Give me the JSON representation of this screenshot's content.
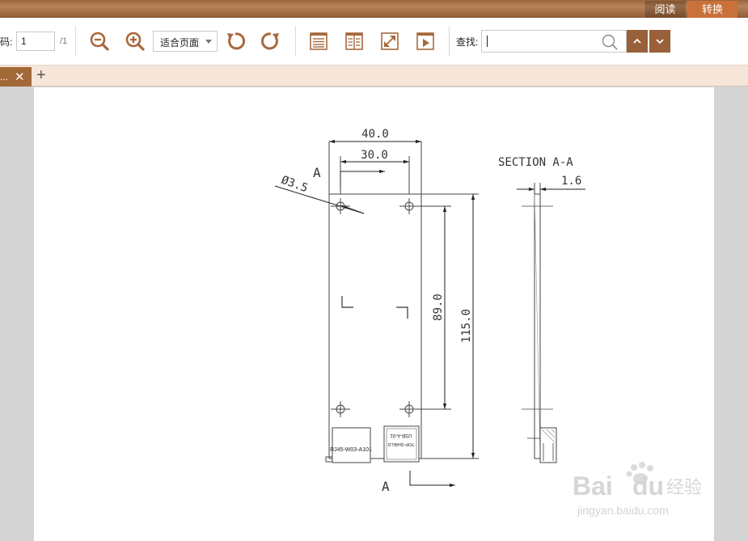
{
  "titlebar": {
    "read_label": "阅读",
    "convert_label": "转换"
  },
  "toolbar": {
    "page_label": "码:",
    "page_value": "1",
    "page_total": "/1",
    "zoom_option": "适合页面",
    "search_label": "查找:",
    "search_value": ""
  },
  "tabbar": {
    "active_tab": "...",
    "close_glyph": "✕",
    "new_tab_glyph": "+"
  },
  "drawing": {
    "dim_40": "40.0",
    "dim_30": "30.0",
    "hole_dia": "Ø3.5",
    "section_marker_top": "A",
    "section_marker_bottom": "A",
    "dim_89": "89.0",
    "dim_115": "115.0",
    "section_title": "SECTION A-A",
    "dim_thickness": "1.6",
    "connector_rj45": "RJ45-W03-A101",
    "connector_usb_line1": "USB-A-01",
    "connector_usb_line2": "TOP-SHIELD"
  },
  "watermark": {
    "brand": "Bai",
    "brand_suffix": "经验",
    "url": "jingyan.baidu.com"
  },
  "colors": {
    "accent": "#99603a",
    "icon": "#a8683d",
    "tab_active": "#a36838",
    "tab_bar": "#f6e6d9"
  }
}
